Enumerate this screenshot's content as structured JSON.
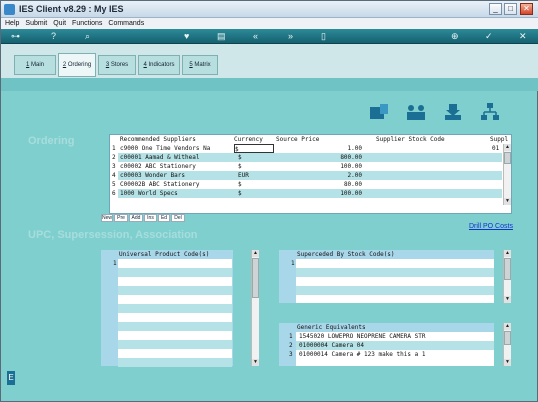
{
  "window": {
    "title": "IES Client v8.29 : My IES",
    "controls": [
      "_",
      "□",
      "✕"
    ]
  },
  "menu": [
    "Help",
    "Submit",
    "Quit",
    "Functions",
    "Commands"
  ],
  "toolbar_icons": [
    "key-icon",
    "help-icon",
    "search-icon",
    "heart-icon",
    "book-icon",
    "rewind-icon",
    "fast-forward-icon",
    "lock-icon",
    "globe-icon",
    "check-icon",
    "close-icon"
  ],
  "tabs": [
    {
      "num": "1",
      "label": "Main"
    },
    {
      "num": "2",
      "label": "Ordering"
    },
    {
      "num": "3",
      "label": "Stores"
    },
    {
      "num": "4",
      "label": "Indicators"
    },
    {
      "num": "5",
      "label": "Matrix"
    }
  ],
  "sections": {
    "ordering": "Ordering",
    "upc": "UPC, Supersession, Association"
  },
  "suppliers": {
    "headers": [
      "Recommended Suppliers",
      "Currency",
      "Source Price",
      "Supplier Stock Code",
      "Suppl"
    ],
    "rows": [
      {
        "n": "1",
        "name": "c9000 One Time Vendors Na",
        "cur": "$",
        "price": "1.00",
        "code": "",
        "extra": "01"
      },
      {
        "n": "2",
        "name": "c00001 Aamad & Witheal",
        "cur": "$",
        "price": "800.00",
        "code": "",
        "extra": ""
      },
      {
        "n": "3",
        "name": "c00002 ABC Stationery",
        "cur": "$",
        "price": "100.00",
        "code": "",
        "extra": ""
      },
      {
        "n": "4",
        "name": "c00003 Wonder Bars",
        "cur": "EUR",
        "price": "2.00",
        "code": "",
        "extra": ""
      },
      {
        "n": "5",
        "name": "C00002B ABC Stationery",
        "cur": "$",
        "price": "80.00",
        "code": "",
        "extra": ""
      },
      {
        "n": "6",
        "name": "1000 World Specs",
        "cur": "$",
        "price": "100.00",
        "code": "",
        "extra": ""
      }
    ],
    "buttons": [
      "New",
      "Pre",
      "Add",
      "Ins",
      "Ed",
      "Del"
    ]
  },
  "drill_link": "Drill PO Costs",
  "upc": {
    "header": "Universal Product Code(s)",
    "rows": [
      {
        "n": "1",
        "v": ""
      }
    ]
  },
  "superseded": {
    "header": "Superceded By Stock Code(s)",
    "rows": [
      {
        "n": "1",
        "v": ""
      }
    ]
  },
  "generic": {
    "header": "Generic Equivalents",
    "rows": [
      {
        "n": "1",
        "v": "1545020 LOWEPRO NEOPRENE CAMERA STR"
      },
      {
        "n": "2",
        "v": "01000004 Camera 04"
      },
      {
        "n": "3",
        "v": "01000014 Camera # 123 make this a 1"
      }
    ]
  },
  "colors": {
    "panel": "#7fcfcf",
    "toolbar": "#156170",
    "section": "#a7dddd",
    "link": "#1133cc",
    "stripe": "#b5e2e6"
  }
}
